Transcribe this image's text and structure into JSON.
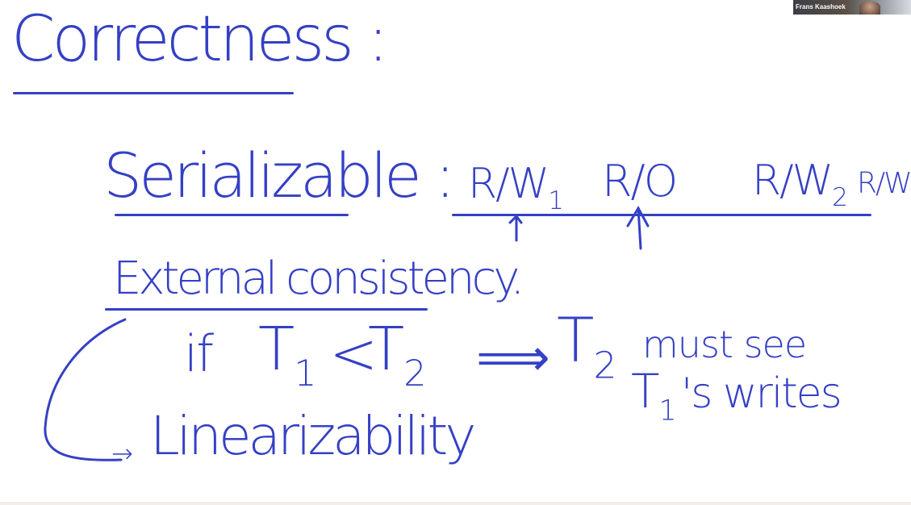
{
  "colors": {
    "ink": "#3540c4",
    "background": "#ffffff"
  },
  "webcam": {
    "participant_name": "Frans Kaashoek"
  },
  "whiteboard": {
    "title": "Correctness :",
    "serializable_label": "Serializable :",
    "timeline": {
      "rw1": "R/W",
      "rw1_sub": "1",
      "ro": "R/O",
      "rw2": "R/W",
      "rw2_sub": "2",
      "rw_cut": "R/W"
    },
    "external_consistency": "External consistency.",
    "rule": {
      "if": "if",
      "t1": "T",
      "t1_sub": "1",
      "lt": "<",
      "t2": "T",
      "t2_sub": "2",
      "implies": "⟹",
      "t2b": "T",
      "t2b_sub": "2",
      "must_see": "must see",
      "t1b": "T",
      "t1b_sub": "1",
      "writes": "'s writes"
    },
    "linearizability_arrow": "→",
    "linearizability": "Linearizability"
  }
}
